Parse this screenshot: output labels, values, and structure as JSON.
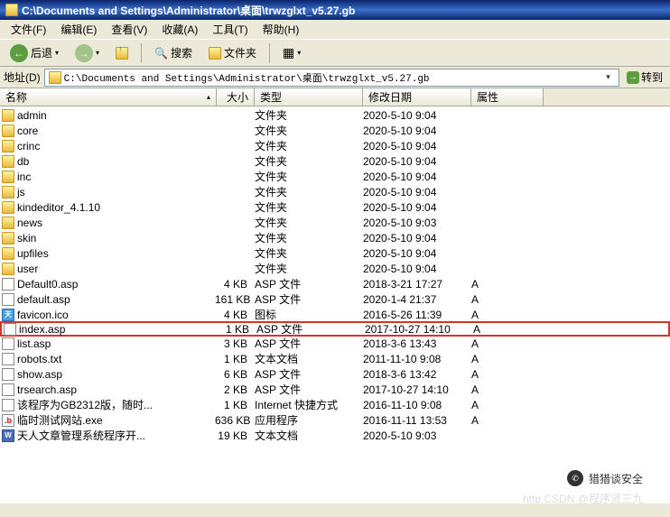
{
  "title": "C:\\Documents and Settings\\Administrator\\桌面\\trwzglxt_v5.27.gb",
  "menu": {
    "file": "文件(F)",
    "edit": "编辑(E)",
    "view": "查看(V)",
    "fav": "收藏(A)",
    "tools": "工具(T)",
    "help": "帮助(H)"
  },
  "toolbar": {
    "back": "后退",
    "search": "搜索",
    "folders": "文件夹"
  },
  "address": {
    "label": "地址(D)",
    "path": "C:\\Documents and Settings\\Administrator\\桌面\\trwzglxt_v5.27.gb",
    "go": "转到"
  },
  "columns": {
    "name": "名称",
    "size": "大小",
    "type": "类型",
    "date": "修改日期",
    "attr": "属性"
  },
  "files": [
    {
      "icon": "folder",
      "name": "admin",
      "size": "",
      "type": "文件夹",
      "date": "2020-5-10 9:04",
      "attr": ""
    },
    {
      "icon": "folder",
      "name": "core",
      "size": "",
      "type": "文件夹",
      "date": "2020-5-10 9:04",
      "attr": ""
    },
    {
      "icon": "folder",
      "name": "crinc",
      "size": "",
      "type": "文件夹",
      "date": "2020-5-10 9:04",
      "attr": ""
    },
    {
      "icon": "folder",
      "name": "db",
      "size": "",
      "type": "文件夹",
      "date": "2020-5-10 9:04",
      "attr": ""
    },
    {
      "icon": "folder",
      "name": "inc",
      "size": "",
      "type": "文件夹",
      "date": "2020-5-10 9:04",
      "attr": ""
    },
    {
      "icon": "folder",
      "name": "js",
      "size": "",
      "type": "文件夹",
      "date": "2020-5-10 9:04",
      "attr": ""
    },
    {
      "icon": "folder",
      "name": "kindeditor_4.1.10",
      "size": "",
      "type": "文件夹",
      "date": "2020-5-10 9:04",
      "attr": ""
    },
    {
      "icon": "folder",
      "name": "news",
      "size": "",
      "type": "文件夹",
      "date": "2020-5-10 9:03",
      "attr": ""
    },
    {
      "icon": "folder",
      "name": "skin",
      "size": "",
      "type": "文件夹",
      "date": "2020-5-10 9:04",
      "attr": ""
    },
    {
      "icon": "folder",
      "name": "upfiles",
      "size": "",
      "type": "文件夹",
      "date": "2020-5-10 9:04",
      "attr": ""
    },
    {
      "icon": "folder",
      "name": "user",
      "size": "",
      "type": "文件夹",
      "date": "2020-5-10 9:04",
      "attr": ""
    },
    {
      "icon": "asp",
      "name": "Default0.asp",
      "size": "4 KB",
      "type": "ASP 文件",
      "date": "2018-3-21 17:27",
      "attr": "A"
    },
    {
      "icon": "asp",
      "name": "default.asp",
      "size": "161 KB",
      "type": "ASP 文件",
      "date": "2020-1-4 21:37",
      "attr": "A"
    },
    {
      "icon": "ico",
      "name": "favicon.ico",
      "size": "4 KB",
      "type": "图标",
      "date": "2016-5-26 11:39",
      "attr": "A"
    },
    {
      "icon": "asp",
      "name": "index.asp",
      "size": "1 KB",
      "type": "ASP 文件",
      "date": "2017-10-27 14:10",
      "attr": "A",
      "hl": true
    },
    {
      "icon": "asp",
      "name": "list.asp",
      "size": "3 KB",
      "type": "ASP 文件",
      "date": "2018-3-6 13:43",
      "attr": "A"
    },
    {
      "icon": "txt",
      "name": "robots.txt",
      "size": "1 KB",
      "type": "文本文档",
      "date": "2011-11-10 9:08",
      "attr": "A"
    },
    {
      "icon": "asp",
      "name": "show.asp",
      "size": "6 KB",
      "type": "ASP 文件",
      "date": "2018-3-6 13:42",
      "attr": "A"
    },
    {
      "icon": "asp",
      "name": "trsearch.asp",
      "size": "2 KB",
      "type": "ASP 文件",
      "date": "2017-10-27 14:10",
      "attr": "A"
    },
    {
      "icon": "lnk",
      "name": "该程序为GB2312版，随时...",
      "size": "1 KB",
      "type": "Internet 快捷方式",
      "date": "2016-11-10 9:08",
      "attr": "A"
    },
    {
      "icon": "exe",
      "name": "临时测试网站.exe",
      "size": "636 KB",
      "type": "应用程序",
      "date": "2016-11-11 13:53",
      "attr": "A"
    },
    {
      "icon": "doc",
      "name": "天人文章管理系统程序开...",
      "size": "19 KB",
      "type": "文本文档",
      "date": "2020-5-10 9:03",
      "attr": ""
    }
  ],
  "watermark1": "http CSDN @程序贤三九",
  "watermark2": "猎猎谈安全"
}
